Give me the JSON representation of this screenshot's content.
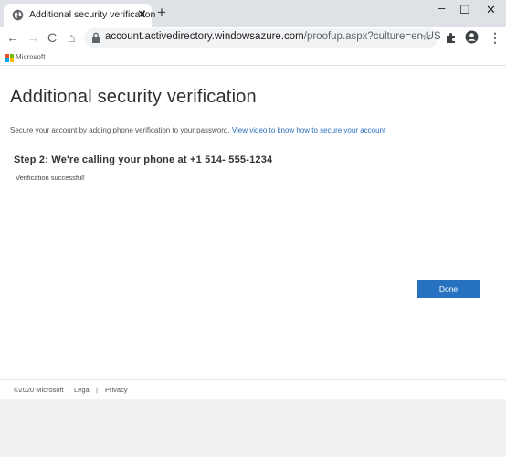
{
  "browser": {
    "tab_title": "Additional security verification",
    "tab_close": "✕",
    "new_tab": "+",
    "window_minimize": "–",
    "window_maximize": "☐",
    "window_close": "✕",
    "back_icon": "←",
    "forward_icon": "→",
    "reload_icon": "C",
    "home_icon": "⌂",
    "url_domain": "account.activedirectory.windowsazure.com",
    "url_path": "/proofup.aspx?culture=en-US",
    "star_icon": "☆",
    "menu_icon": "⋮"
  },
  "brand": {
    "name": "Microsoft",
    "logo_colors": [
      "#f25022",
      "#7fba00",
      "#00a4ef",
      "#ffb900"
    ]
  },
  "main": {
    "title": "Additional security verification",
    "intro_text": "Secure your account by adding phone verification to your password.",
    "intro_link": "View video to know how to secure your account",
    "step_heading": "Step 2: We're calling your phone at +1 514- 555-1234",
    "status_text": "Verification successful!",
    "done_label": "Done"
  },
  "footer": {
    "copyright": "©2020 Microsoft",
    "legal": "Legal",
    "separator": "|",
    "privacy": "Privacy"
  },
  "colors": {
    "accent": "#2672c0",
    "link": "#2a6ebb"
  }
}
